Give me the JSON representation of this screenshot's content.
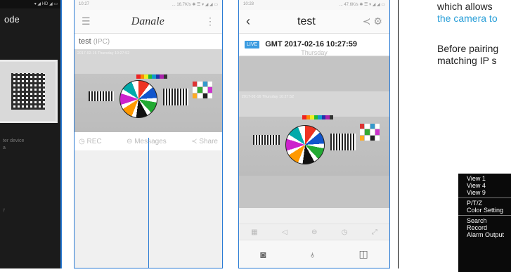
{
  "phone1": {
    "title": "ode",
    "hint": "ter device",
    "hint_line2": "a",
    "footer": "y"
  },
  "phone2": {
    "status_time": "10:27",
    "status_right": "... 16.7K/s ✱ ☰ ▾ ◢ ◢ ▭",
    "brand": "Danale",
    "device_name": "test",
    "device_tag": "(IPC)",
    "osd": "2017-02-16 Thursday 10:27:52",
    "actions": [
      {
        "icon": "clock-icon",
        "label": "REC"
      },
      {
        "icon": "message-icon",
        "label": "Messages"
      },
      {
        "icon": "share-icon",
        "label": "Share"
      }
    ]
  },
  "phone3": {
    "status_time": "10:28",
    "status_right": "... 47.6K/s ✱ ☰ ▾ ◢ ◢ ▭",
    "title": "test",
    "live_badge": "LIVE",
    "gmt": "GMT 2017-02-16  10:27:59",
    "day": "Thursday",
    "osd": "2017-02-16 Thursday 10:27:52"
  },
  "text_lines": [
    {
      "text": "which allows",
      "color": "#222222"
    },
    {
      "text": "the camera to",
      "color": "#2a9fd8"
    },
    {
      "text": "Before pairing",
      "color": "#222222"
    },
    {
      "text": "matching IP s",
      "color": "#222222"
    }
  ],
  "menu": {
    "groups": [
      [
        "View 1",
        "View 4",
        "View 9"
      ],
      [
        "P/T/Z",
        "Color Setting"
      ],
      [
        "Search",
        "Record",
        "Alarm Output"
      ]
    ]
  }
}
